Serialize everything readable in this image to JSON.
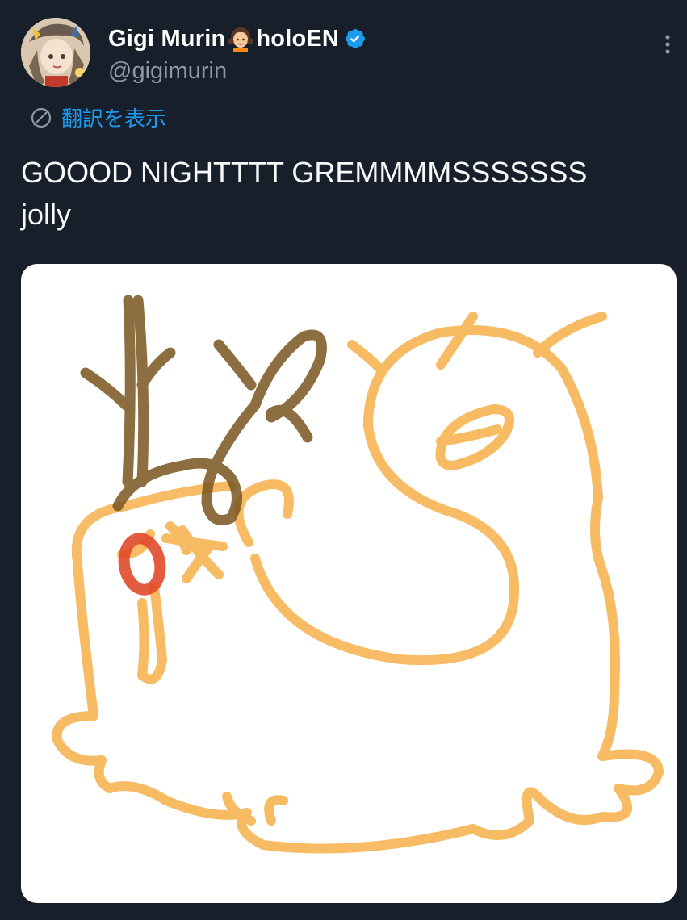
{
  "author": {
    "display_name": "Gigi Murin",
    "display_name_suffix": "holoEN",
    "emoji": "girl-emoji",
    "handle": "@gigimurin",
    "verified": true,
    "verified_color": "#1d9bf0"
  },
  "translate": {
    "label": "翻訳を表示",
    "icon": "globe-icon",
    "color": "#1d9bf0"
  },
  "tweet": {
    "text": "GOOOD NIGHTTTT GREMMMMSSSSSSS\njolly"
  },
  "media": {
    "alt": "",
    "background": "#ffffff"
  },
  "theme": {
    "background": "#161f2a",
    "text": "#f7f9f9",
    "muted": "#8b98a5"
  }
}
